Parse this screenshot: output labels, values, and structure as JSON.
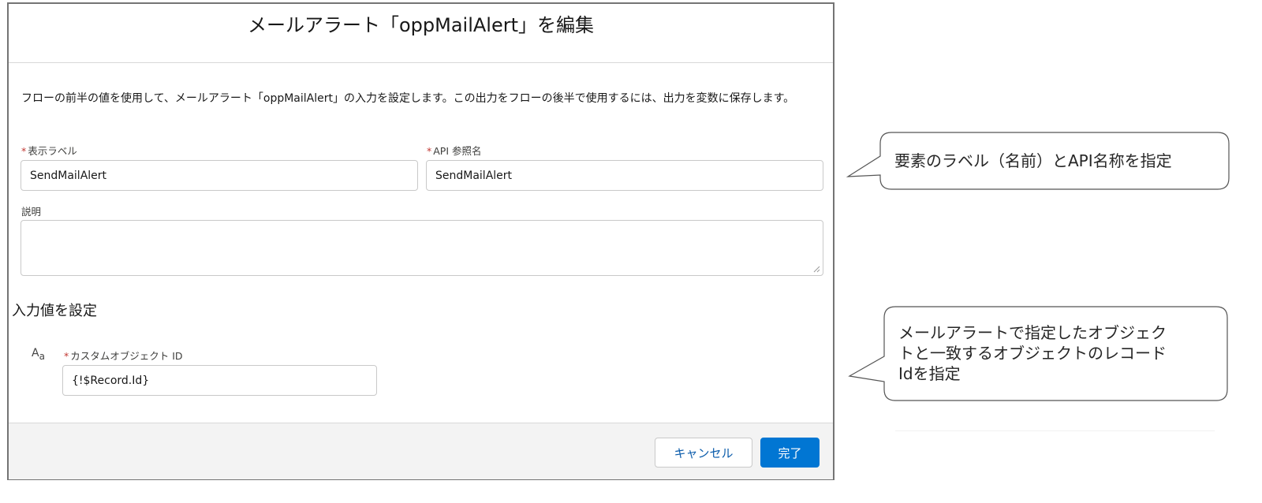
{
  "dialog": {
    "title": "メールアラート「oppMailAlert」を編集",
    "description": "フローの前半の値を使用して、メールアラート「oppMailAlert」の入力を設定します。この出力をフローの後半で使用するには、出力を変数に保存します。",
    "label_field": {
      "required_mark": "*",
      "label": "表示ラベル",
      "value": "SendMailAlert"
    },
    "api_name_field": {
      "required_mark": "*",
      "label": "API 参照名",
      "value": "SendMailAlert"
    },
    "description_field": {
      "label": "説明",
      "value": ""
    },
    "input_section": {
      "title": "入力値を設定",
      "type_icon": "text-type-icon",
      "type_icon_glyph_a": "A",
      "type_icon_glyph_b": "a",
      "custom_object_field": {
        "required_mark": "*",
        "label": "カスタムオブジェクト ID",
        "value": "{!$Record.Id}"
      }
    },
    "footer": {
      "cancel_label": "キャンセル",
      "done_label": "完了"
    }
  },
  "annotations": {
    "callout_1": "要素のラベル（名前）とAPI名称を指定",
    "callout_2_line1": "メールアラートで指定したオブジェク",
    "callout_2_line2": "トと一致するオブジェクトのレコード",
    "callout_2_line3": "Idを指定"
  },
  "colors": {
    "brand_blue": "#0176d3",
    "required_red": "#c23934",
    "link_blue": "#0b5cab"
  }
}
